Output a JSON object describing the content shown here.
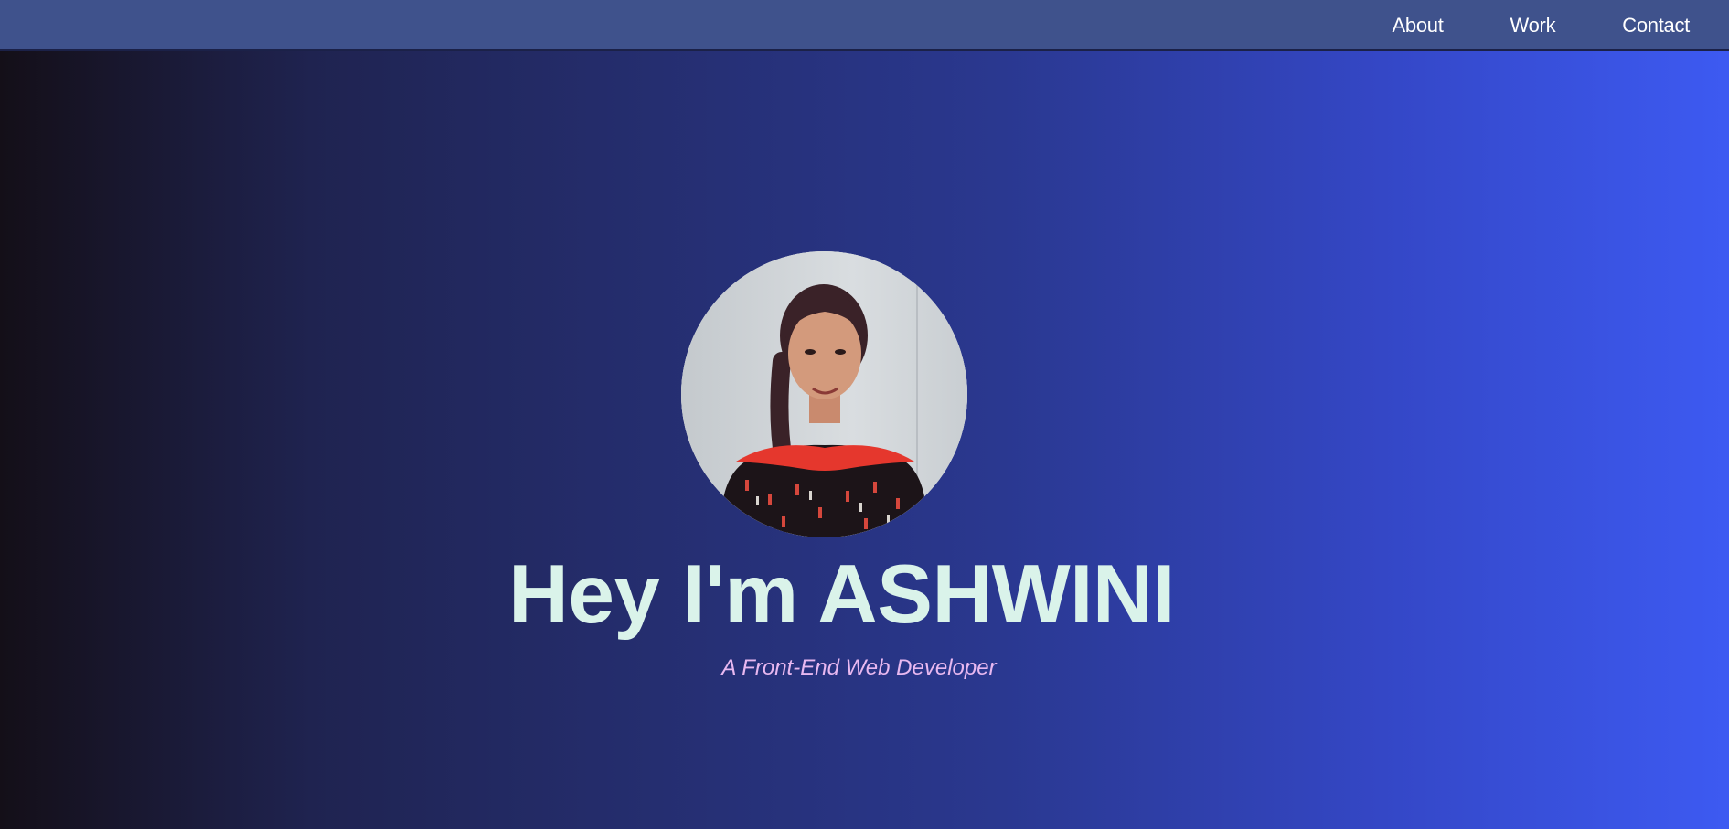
{
  "nav": {
    "items": [
      {
        "label": "About"
      },
      {
        "label": "Work"
      },
      {
        "label": "Contact"
      }
    ]
  },
  "hero": {
    "title": "Hey I'm ASHWINI",
    "subtitle": "A Front-End Web Developer"
  },
  "colors": {
    "navbar": "#3f528c",
    "title": "#daf3ea",
    "subtitle": "#e8b8f0",
    "gradient_start": "#140f18",
    "gradient_end": "#3d5af2"
  }
}
